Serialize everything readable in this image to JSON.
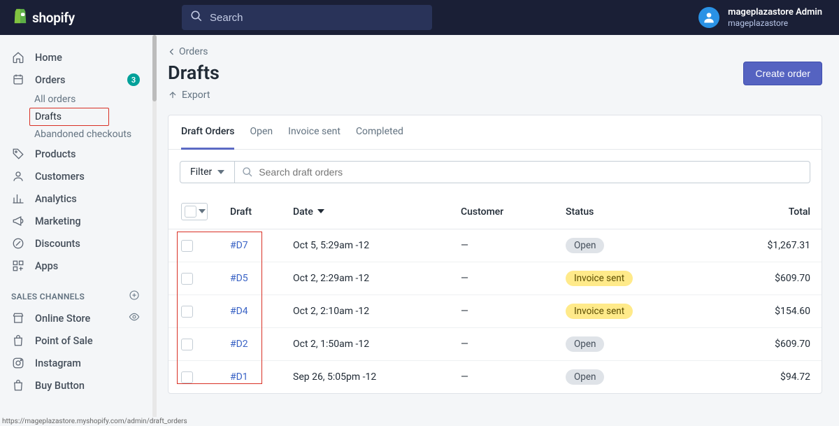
{
  "topbar": {
    "brand": "shopify",
    "search_placeholder": "Search",
    "user_name": "mageplazastore Admin",
    "user_store": "mageplazastore"
  },
  "sidebar": {
    "home": "Home",
    "orders": "Orders",
    "orders_badge": "3",
    "all_orders": "All orders",
    "drafts": "Drafts",
    "abandoned": "Abandoned checkouts",
    "products": "Products",
    "customers": "Customers",
    "analytics": "Analytics",
    "marketing": "Marketing",
    "discounts": "Discounts",
    "apps": "Apps",
    "sales_channels": "SALES CHANNELS",
    "online_store": "Online Store",
    "pos": "Point of Sale",
    "instagram": "Instagram",
    "buy_button": "Buy Button"
  },
  "page": {
    "back": "Orders",
    "title": "Drafts",
    "export": "Export",
    "create_order": "Create order"
  },
  "tabs": {
    "draft_orders": "Draft Orders",
    "open": "Open",
    "invoice_sent": "Invoice sent",
    "completed": "Completed"
  },
  "filter": {
    "label": "Filter",
    "search_placeholder": "Search draft orders"
  },
  "table": {
    "headers": {
      "draft": "Draft",
      "date": "Date",
      "customer": "Customer",
      "status": "Status",
      "total": "Total"
    },
    "rows": [
      {
        "id": "#D7",
        "date": "Oct 5, 5:29am -12",
        "customer": "—",
        "status": "Open",
        "status_type": "open",
        "total": "$1,267.31"
      },
      {
        "id": "#D5",
        "date": "Oct 2, 2:29am -12",
        "customer": "—",
        "status": "Invoice sent",
        "status_type": "invoice",
        "total": "$609.70"
      },
      {
        "id": "#D4",
        "date": "Oct 2, 2:10am -12",
        "customer": "—",
        "status": "Invoice sent",
        "status_type": "invoice",
        "total": "$154.60"
      },
      {
        "id": "#D2",
        "date": "Oct 2, 1:50am -12",
        "customer": "—",
        "status": "Open",
        "status_type": "open",
        "total": "$609.70"
      },
      {
        "id": "#D1",
        "date": "Sep 26, 5:05pm -12",
        "customer": "—",
        "status": "Open",
        "status_type": "open",
        "total": "$94.72"
      }
    ]
  },
  "status_url": "https://mageplazastore.myshopify.com/admin/draft_orders"
}
